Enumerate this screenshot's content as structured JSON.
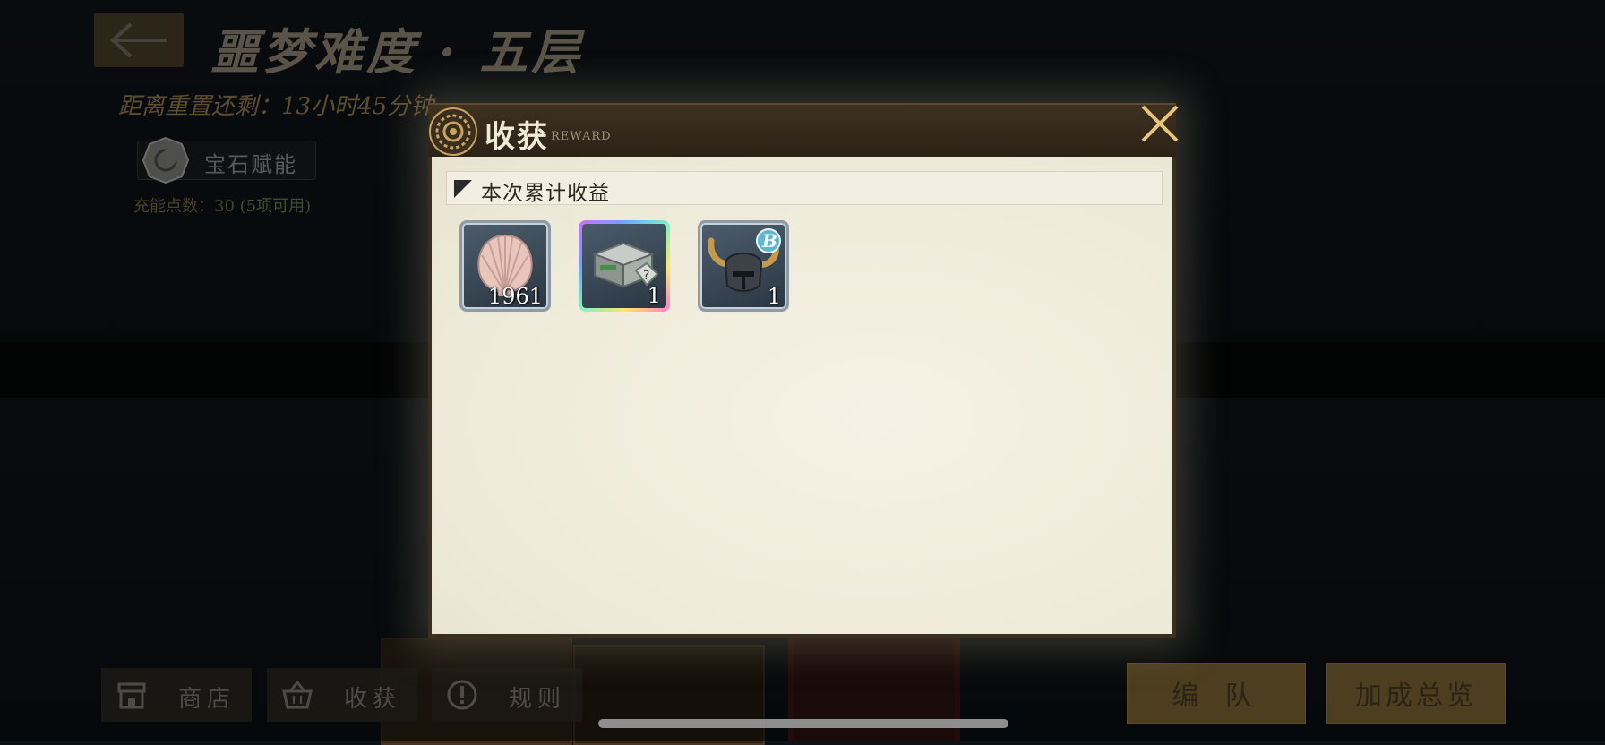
{
  "hud": {
    "page_title": "噩梦难度 · 五层",
    "reset_timer": "距离重置还剩：13小时45分钟",
    "gem_button_label": "宝石赋能",
    "charge_points_label": "充能点数：30",
    "charge_available": "(5项可用)"
  },
  "bottom_bar": {
    "shop_label": "商店",
    "harvest_label": "收获",
    "rules_label": "规则",
    "team_label": "编 队",
    "bonus_overview_label": "加成总览"
  },
  "modal": {
    "title": "收获",
    "subtitle": "REWARD",
    "section_title": "本次累计收益",
    "items": [
      {
        "icon": "seashell-icon",
        "count": "1961",
        "rarity": "normal"
      },
      {
        "icon": "mystery-chest-icon",
        "count": "1",
        "rarity": "rainbow"
      },
      {
        "icon": "horned-helmet-icon",
        "count": "1",
        "rarity": "normal",
        "grade": "B"
      }
    ]
  },
  "colors": {
    "accent_gold": "#e7c57a",
    "modal_paper": "#f3efe2",
    "header_brown": "#3a2e1e"
  }
}
